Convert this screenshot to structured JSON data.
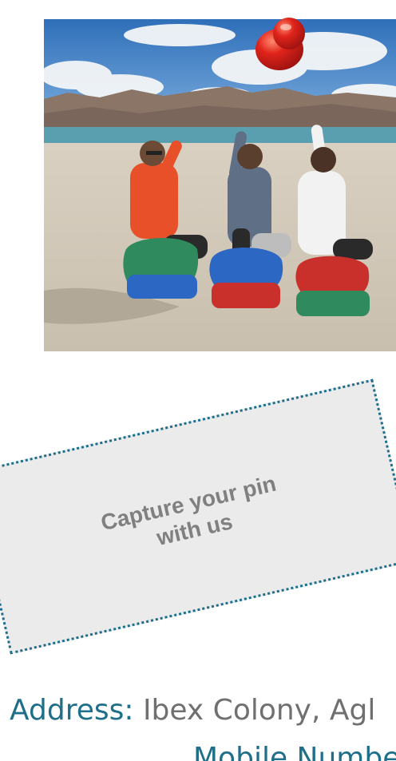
{
  "photo": {
    "alt": "",
    "colors": {
      "sky": "#3f7fc8",
      "cloud": "#f4f6f8",
      "mountain": "#8a7566",
      "lake": "#5a9fb0",
      "sand": "#d8cfc1",
      "jacket_orange": "#e8502a",
      "jacket_grey": "#5f6f86",
      "jacket_white": "#f2f2f2",
      "seat_green": "#2f8a5e",
      "seat_blue": "#2b67c3",
      "seat_red": "#c9302c"
    }
  },
  "pin": {
    "icon": "push-pin-icon",
    "color": "#e0241b"
  },
  "placeholder": {
    "text": "Capture your pin with us",
    "border_color": "#1c6f8c"
  },
  "contact": {
    "address_label": "Address:",
    "address_value": " Ibex Colony, Agl",
    "mobile_label": "Mobile Number"
  }
}
